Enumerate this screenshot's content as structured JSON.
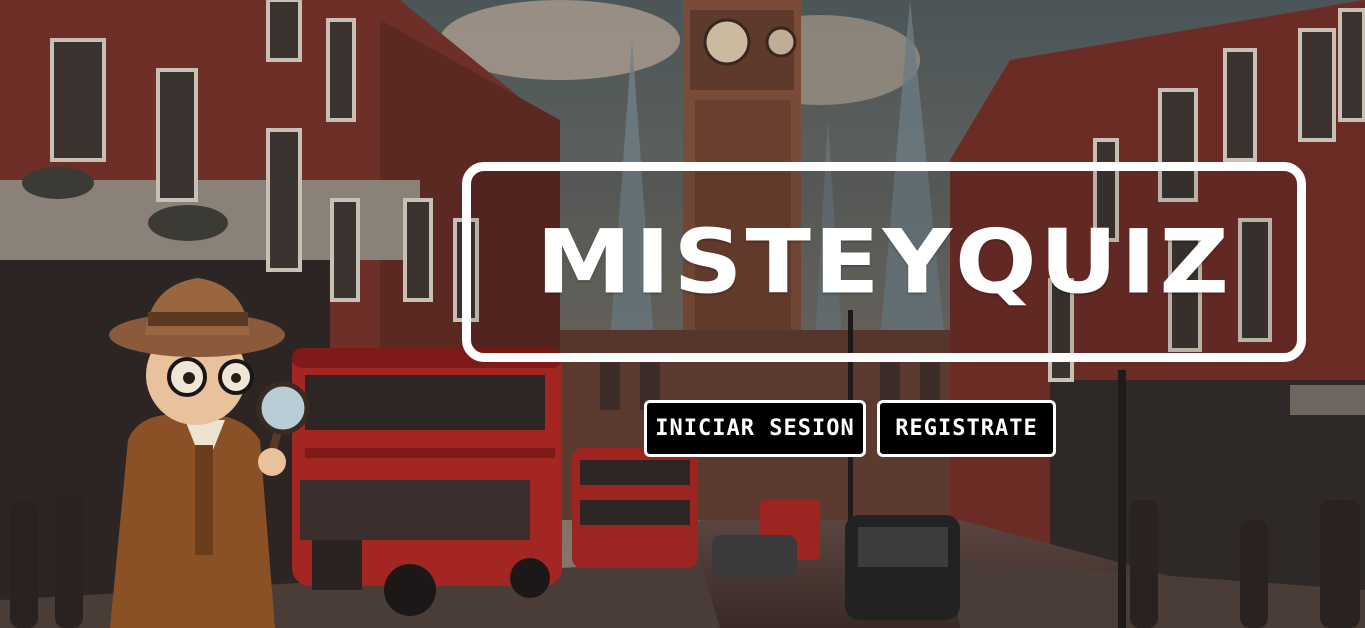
{
  "hero": {
    "title": "MISTEYQUIZ"
  },
  "actions": {
    "login_label": "INICIAR SESION",
    "register_label": "REGISTRATE"
  },
  "colors": {
    "button_bg": "#000000",
    "button_border": "#ffffff",
    "title_color": "#ffffff",
    "bus_red": "#a32622",
    "brick": "#6e2f28"
  }
}
